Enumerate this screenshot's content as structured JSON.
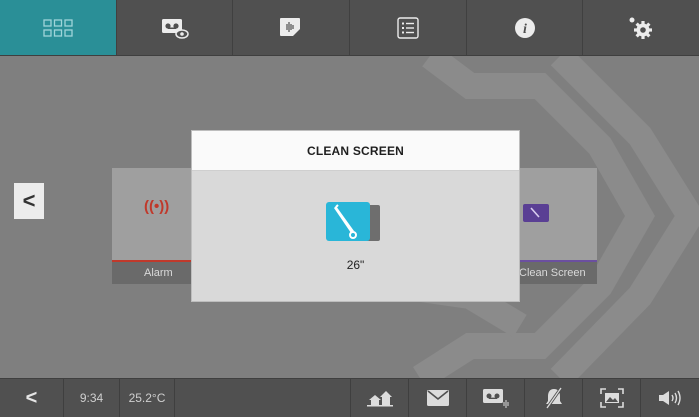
{
  "topbar": {
    "tabs": [
      {
        "icon": "grid-icon",
        "active": true
      },
      {
        "icon": "voicemail-view-icon",
        "active": false
      },
      {
        "icon": "intercom-icon",
        "active": false
      },
      {
        "icon": "list-icon",
        "active": false
      },
      {
        "icon": "info-icon",
        "active": false
      },
      {
        "icon": "settings-icon",
        "active": false
      }
    ],
    "info_glyph": "i"
  },
  "carousel": {
    "prev_glyph": "<",
    "cards": [
      {
        "label": "Alarm",
        "icon": "alarm-icon",
        "icon_glyph": "((•))",
        "accent": "#c0392b"
      },
      {
        "label": "Clean Screen",
        "icon": "clean-screen-icon",
        "accent": "#6b4fa0"
      }
    ]
  },
  "modal": {
    "title": "CLEAN SCREEN",
    "icon": "clean-screen-icon",
    "icon_color": "#29b6d8",
    "countdown": "26\""
  },
  "bottombar": {
    "back_glyph": "<",
    "time": "9:34",
    "temperature": "25.2°C",
    "icons": [
      "home-away-icon",
      "envelope-icon",
      "voicemail-icon",
      "mute-icon",
      "photo-icon",
      "volume-icon"
    ]
  },
  "colors": {
    "accent_teal": "#2a8f97",
    "bar_gray": "#505050",
    "stage_gray": "#7f7f7f"
  }
}
